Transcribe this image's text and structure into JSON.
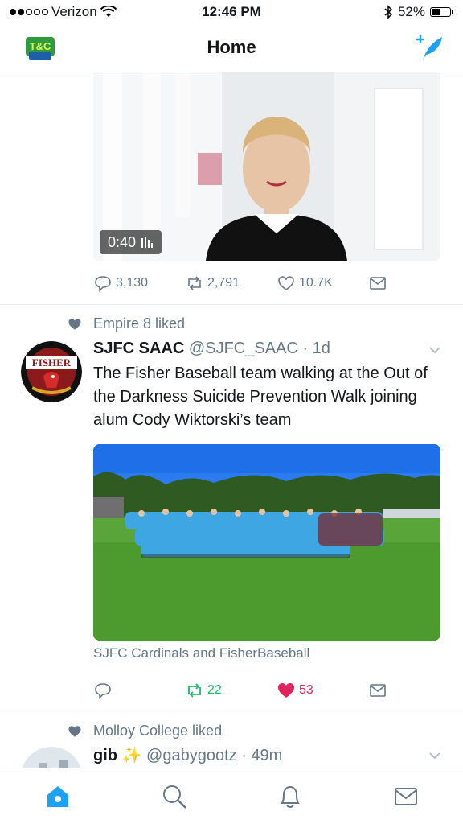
{
  "status_bar": {
    "carrier": "Verizon",
    "time": "12:46 PM",
    "battery": "52%",
    "battery_level": 0.52
  },
  "nav": {
    "title": "Home"
  },
  "tweet1": {
    "video_duration": "0:40",
    "replies": "3,130",
    "retweets": "2,791",
    "likes": "10.7K"
  },
  "tweet2": {
    "social_context": "Empire 8 liked",
    "name": "SJFC SAAC",
    "handle": "@SJFC_SAAC",
    "time": "· 1d",
    "avatar_text": "FISHER",
    "text": "The Fisher Baseball team walking at the Out of the Darkness Suicide Prevention Walk joining alum Cody Wiktorski’s team",
    "caption": "SJFC Cardinals and FisherBaseball",
    "retweets": "22",
    "likes": "53"
  },
  "tweet3": {
    "social_context": "Molloy College liked",
    "name": "gib",
    "emoji": "✨",
    "handle": "@gabygootz",
    "time": "· 49m"
  },
  "colors": {
    "accent": "#1da1f2",
    "retweet": "#17bf63",
    "like": "#e0245e",
    "muted": "#657786"
  }
}
